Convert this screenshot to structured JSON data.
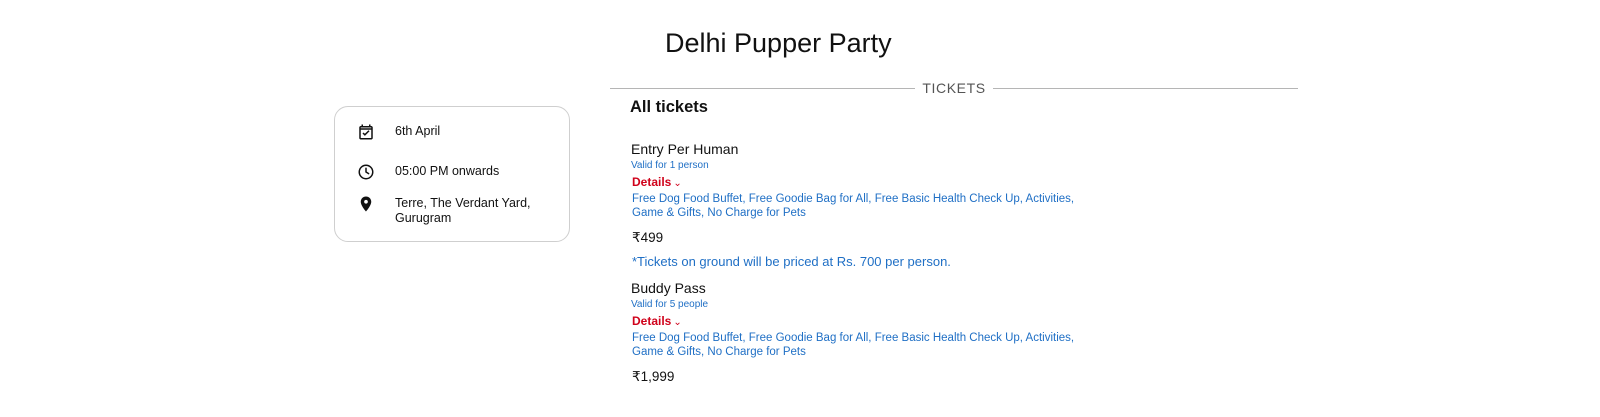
{
  "event": {
    "title": "Delhi Pupper Party",
    "tickets_label": "TICKETS",
    "all_tickets_label": "All tickets"
  },
  "info": {
    "date": "6th April",
    "time": "05:00 PM onwards",
    "venue": "Terre, The Verdant Yard, Gurugram",
    "icons": [
      "calendar-check-icon",
      "clock-icon",
      "location-pin-icon"
    ]
  },
  "tickets": [
    {
      "name": "Entry Per Human",
      "validity": "Valid for 1 person",
      "details_label": "Details",
      "benefits": "Free Dog Food Buffet, Free Goodie Bag for All, Free Basic Health Check Up, Activities, Game & Gifts, No Charge for Pets",
      "price": "₹499",
      "note": "*Tickets on ground will be priced at Rs. 700 per person."
    },
    {
      "name": "Buddy Pass",
      "validity": "Valid for 5 people",
      "details_label": "Details",
      "benefits": "Free Dog Food Buffet, Free Goodie Bag for All, Free Basic Health Check Up, Activities, Game & Gifts, No Charge for Pets",
      "price": "₹1,999"
    }
  ],
  "colors": {
    "link_blue": "#1f6fc5",
    "details_red": "#d0021b",
    "text": "#111111",
    "divider": "#b5b5b5"
  }
}
